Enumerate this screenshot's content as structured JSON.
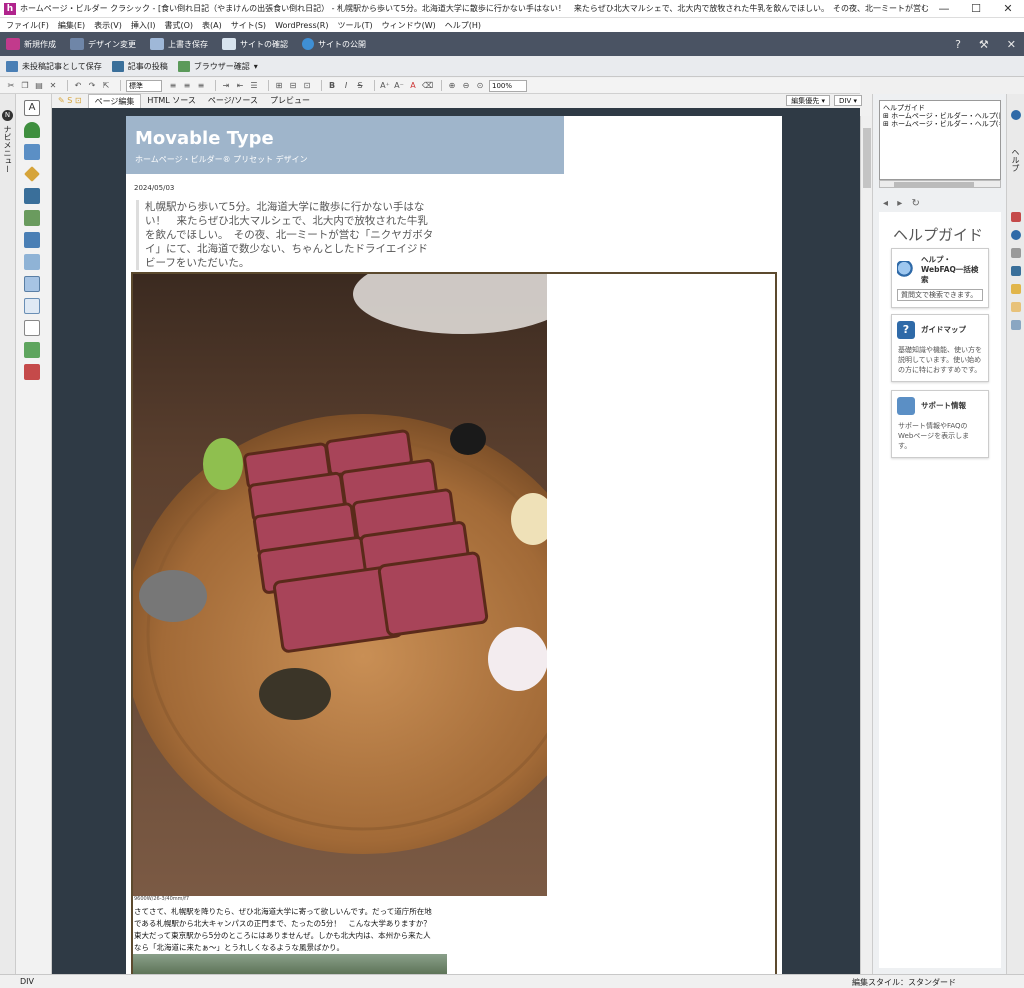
{
  "window": {
    "title": "ホームページ・ビルダー クラシック - [食い倒れ日記（やまけんの出張食い倒れ日記） - 札幌駅から歩いて5分。北海道大学に散歩に行かない手はない！　来たらぜひ北大マルシェで、北大内で放牧された牛乳を飲んでほしい。　その夜、北一ミートが営む「ニクヤガボタイ」にて、北海道で数少ない、ちゃんとしたドライエイジドビーフ",
    "minimize": "—",
    "maximize": "☐",
    "close": "✕"
  },
  "menu": [
    "ファイル(F)",
    "編集(E)",
    "表示(V)",
    "挿入(I)",
    "書式(O)",
    "表(A)",
    "サイト(S)",
    "WordPress(R)",
    "ツール(T)",
    "ウィンドウ(W)",
    "ヘルプ(H)"
  ],
  "main_toolbar": {
    "new": "新規作成",
    "design_change": "デザイン変更",
    "overwrite_save": "上書き保存",
    "site_check": "サイトの確認",
    "site_publish": "サイトの公開",
    "help_icon": "?",
    "tools_icon": "⚒",
    "close_icon": "✕"
  },
  "secondary_toolbar": {
    "save_unposted": "未投稿記事として保存",
    "post_article": "記事の投稿",
    "browser_check": "ブラウザー確認",
    "dropdown": "▾"
  },
  "format_toolbar": {
    "style_select": "標準",
    "zoom_select": "100%"
  },
  "tabs": {
    "page_edit": "ページ編集",
    "html_source": "HTML ソース",
    "page_source": "ページ/ソース",
    "preview": "プレビュー",
    "edit_priority": "編集優先 ▾",
    "div": "DIV ▾"
  },
  "left_strip": {
    "nav_label": "ナビメニュー"
  },
  "page": {
    "site_title": "Movable Type",
    "site_subtitle": "ホームページ・ビルダー® プリセット デザイン",
    "date": "2024/05/03",
    "lead": "札幌駅から歩いて5分。北海道大学に散歩に行かない手はない！　来たらぜひ北大マルシェで、北大内で放牧された牛乳を飲んでほしい。　その夜、北一ミートが営む「ニクヤガボタイ」にて、北海道で数少ない、ちゃんとしたドライエイジドビーフをいただいた。",
    "image_caption": "9600W/26-3/40mm/f7",
    "body": "さてさて、札幌駅を降りたら、ぜひ北海道大学に寄って欲しいんです。だって道庁所在地である札幌駅から北大キャンパスの正門まで、たったの5分！　こんな大学ありますか？　東大だって東京駅から5分のところにはありませんぜ。しかも北大内は、本州から来た人なら「北海道に来たぁ〜」とうれしくなるような風景ばかり。"
  },
  "right_panel": {
    "tree": [
      "ヘルプガイド",
      "⊞ ホームページ・ビルダー・ヘルプ(目次)",
      "⊞ ホームページ・ビルダー・ヘルプ(キーワ"
    ],
    "nav_back": "◂",
    "nav_forward": "▸",
    "nav_refresh": "↻",
    "help_title": "ヘルプガイド",
    "card1_title": "ヘルプ・WebFAQ一括検索",
    "card1_placeholder": "質問文で検索できます。",
    "card2_title": "ガイドマップ",
    "card2_text": "基礎知識や機能、使い方を説明しています。使い始めの方に特におすすめです。",
    "card3_title": "サポート情報",
    "card3_text": "サポート情報やFAQのWebページを表示します。"
  },
  "right_strip": {
    "label": "ヘルプ"
  },
  "status": {
    "left": "DIV",
    "right": "編集スタイル：スタンダード"
  },
  "colors": {
    "toolbar_dark": "#4a5363",
    "header_band": "#9fb5cb",
    "editor_bg": "#2f3a45",
    "frame_border": "#5c4a2e"
  }
}
